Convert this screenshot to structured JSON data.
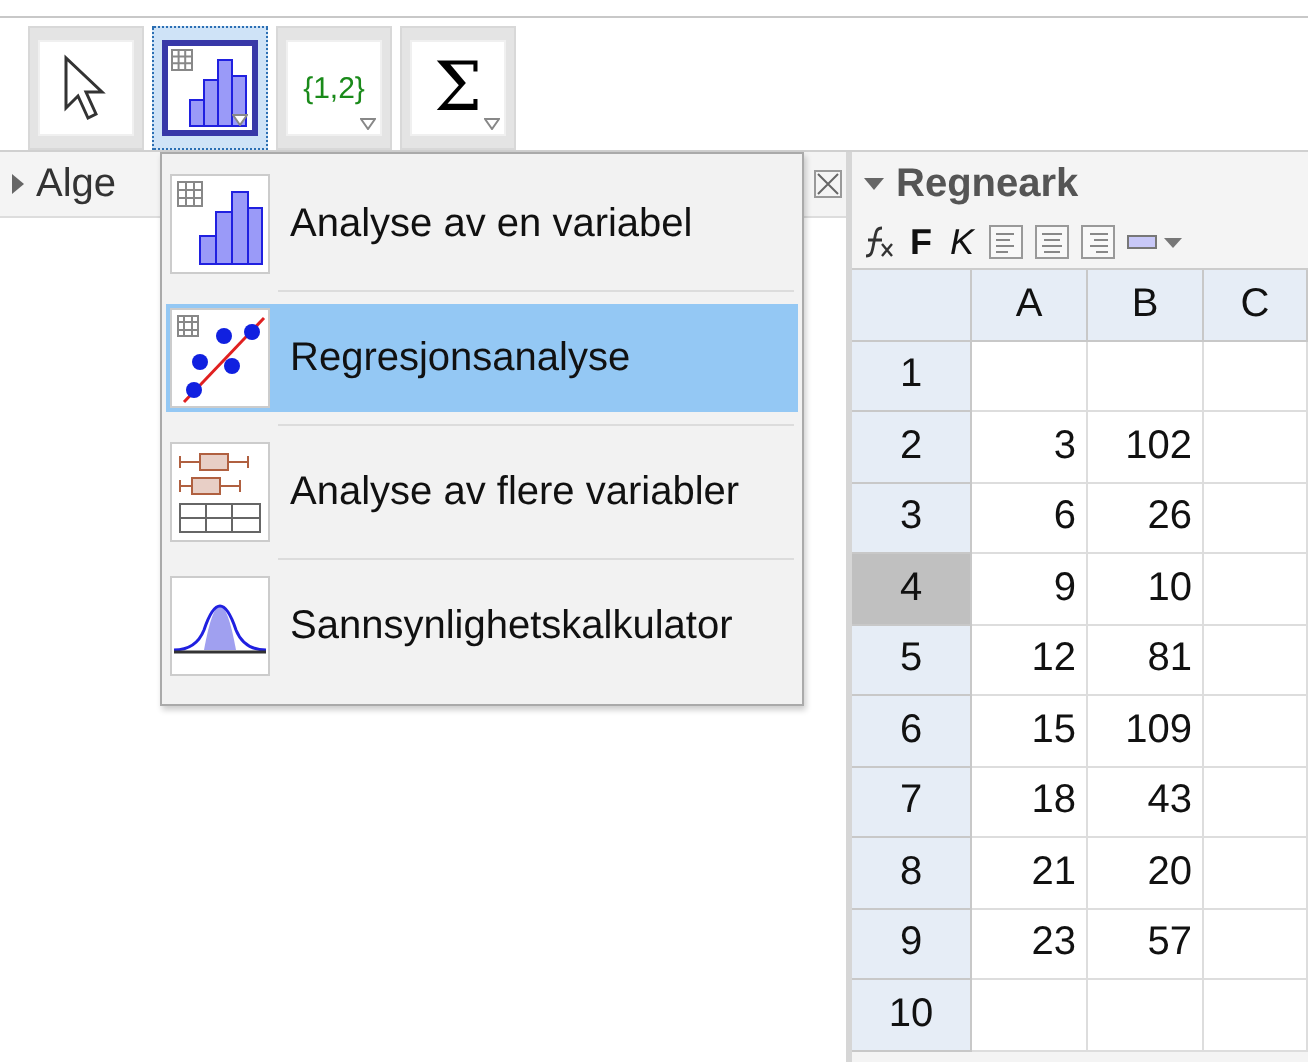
{
  "toolbar": {
    "tools": [
      {
        "kind": "pointer",
        "selected": false
      },
      {
        "kind": "histogram",
        "selected": true
      },
      {
        "kind": "list",
        "label": "{1,2}",
        "selected": false
      },
      {
        "kind": "sum",
        "label": "Σ",
        "selected": false
      }
    ]
  },
  "algebra_panel": {
    "title": "Alge"
  },
  "menu": {
    "items": [
      {
        "kind": "histogram",
        "label": "Analyse av en variabel",
        "selected": false
      },
      {
        "kind": "regression",
        "label": "Regresjonsanalyse",
        "selected": true
      },
      {
        "kind": "boxplot",
        "label": "Analyse av flere variabler",
        "selected": false
      },
      {
        "kind": "bell",
        "label": "Sannsynlighetskalkulator",
        "selected": false
      }
    ]
  },
  "spreadsheet": {
    "title": "Regneark",
    "format_buttons": [
      "F",
      "K"
    ],
    "columns": [
      "A",
      "B",
      "C"
    ],
    "rows": [
      {
        "label": "1",
        "selected": false,
        "cells": [
          "",
          ""
        ]
      },
      {
        "label": "2",
        "selected": false,
        "cells": [
          "3",
          "102"
        ]
      },
      {
        "label": "3",
        "selected": false,
        "cells": [
          "6",
          "26"
        ]
      },
      {
        "label": "4",
        "selected": true,
        "cells": [
          "9",
          "10"
        ]
      },
      {
        "label": "5",
        "selected": false,
        "cells": [
          "12",
          "81"
        ]
      },
      {
        "label": "6",
        "selected": false,
        "cells": [
          "15",
          "109"
        ]
      },
      {
        "label": "7",
        "selected": false,
        "cells": [
          "18",
          "43"
        ]
      },
      {
        "label": "8",
        "selected": false,
        "cells": [
          "21",
          "20"
        ]
      },
      {
        "label": "9",
        "selected": false,
        "cells": [
          "23",
          "57"
        ]
      },
      {
        "label": "10",
        "selected": false,
        "cells": [
          "",
          ""
        ]
      }
    ]
  }
}
